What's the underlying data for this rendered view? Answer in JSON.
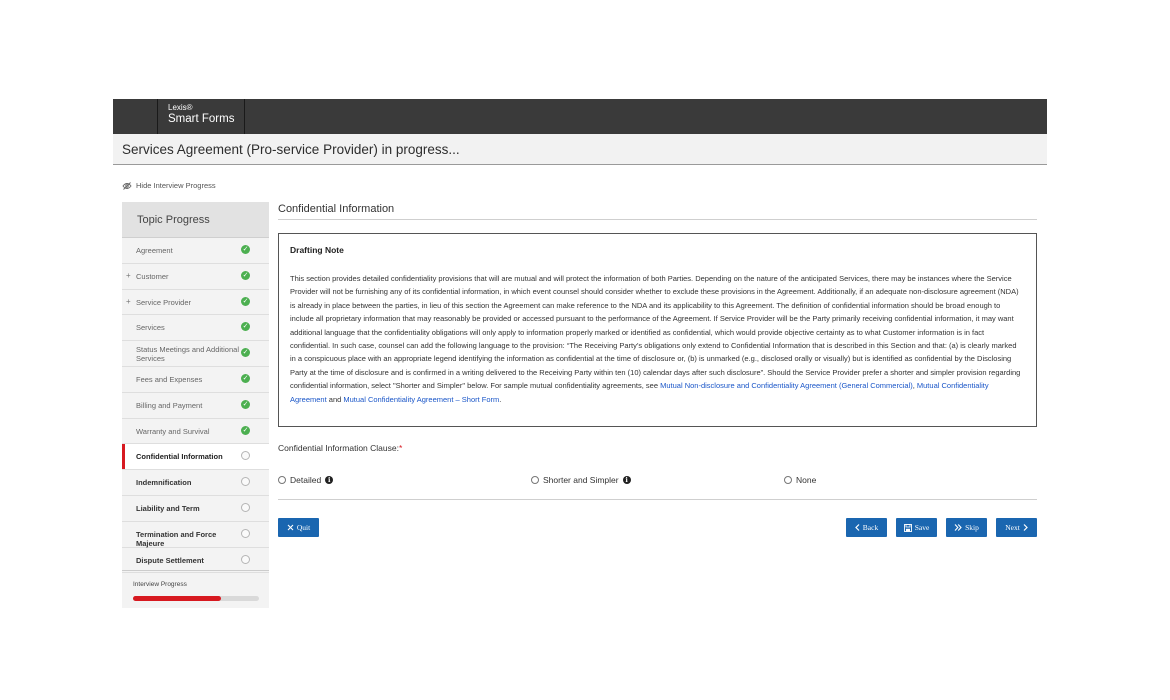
{
  "brand": {
    "line1": "Lexis®",
    "line2": "Smart Forms"
  },
  "page_title": "Services Agreement (Pro-service Provider) in progress...",
  "hide_progress_label": "Hide Interview Progress",
  "sidebar": {
    "heading": "Topic Progress",
    "items": [
      {
        "label": "Agreement",
        "status": "complete"
      },
      {
        "label": "Customer",
        "status": "complete",
        "expandable": true
      },
      {
        "label": "Service Provider",
        "status": "complete",
        "expandable": true
      },
      {
        "label": "Services",
        "status": "complete"
      },
      {
        "label": "Status Meetings and Additional Services",
        "status": "complete"
      },
      {
        "label": "Fees and Expenses",
        "status": "complete"
      },
      {
        "label": "Billing and Payment",
        "status": "complete"
      },
      {
        "label": "Warranty and Survival",
        "status": "complete"
      },
      {
        "label": "Confidential Information",
        "status": "current"
      },
      {
        "label": "Indemnification",
        "status": "incomplete"
      },
      {
        "label": "Liability and Term",
        "status": "incomplete"
      },
      {
        "label": "Termination and Force Majeure",
        "status": "incomplete"
      },
      {
        "label": "Dispute Settlement",
        "status": "incomplete"
      }
    ],
    "progress_label": "Interview Progress",
    "progress_fraction": 0.7
  },
  "section_title": "Confidential Information",
  "drafting_note": {
    "title": "Drafting Note",
    "body": "This section provides detailed confidentiality provisions that will are mutual and will protect the information of both Parties. Depending on the nature of the anticipated Services, there may be instances where the Service Provider will not be furnishing any of its confidential information, in which event counsel should consider whether to exclude these provisions in the Agreement. Additionally, if an adequate non-disclosure agreement (NDA) is already in place between the parties, in lieu of this section the Agreement can make reference to the NDA and its applicability to this Agreement. The definition of confidential information should be broad enough to include all proprietary information that may reasonably be provided or accessed pursuant to the performance of the Agreement. If Service Provider will be the Party primarily receiving confidential information, it may want additional language that the confidentiality obligations will only apply to information properly marked or identified as confidential, which would provide objective certainty as to what Customer information is in fact confidential. In such case, counsel can add the following language to the provision: “The Receiving Party’s obligations only extend to Confidential Information that is described in this Section and that: (a) is clearly marked in a conspicuous place with an appropriate legend identifying the information as confidential at the time of disclosure or, (b) is unmarked (e.g., disclosed orally or visually) but is identified as confidential by the Disclosing Party at the time of disclosure and is confirmed in a writing delivered to the Receiving Party within ten (10) calendar days after such disclosure”. Should the Service Provider prefer a shorter and simpler provision regarding confidential information, select \"Shorter and Simpler\" below. For sample mutual confidentiality agreements, see ",
    "link1": "Mutual Non-disclosure and Confidentiality Agreement (General Commercial)",
    "sep1": ", ",
    "link2": "Mutual Confidentiality Agreement",
    "sep2": " and ",
    "link3": "Mutual Confidentiality Agreement – Short Form",
    "end": "."
  },
  "clause": {
    "label": "Confidential Information Clause:",
    "required_mark": "*",
    "options": [
      {
        "label": "Detailed",
        "info": true
      },
      {
        "label": "Shorter and Simpler",
        "info": true
      },
      {
        "label": "None",
        "info": false
      }
    ]
  },
  "buttons": {
    "quit": "Quit",
    "back": "Back",
    "save": "Save",
    "skip": "Skip",
    "next": "Next"
  },
  "colors": {
    "accent_red": "#d71920",
    "button_blue": "#1a66b0",
    "link_blue": "#1a56c8",
    "done_green": "#4caf50"
  }
}
